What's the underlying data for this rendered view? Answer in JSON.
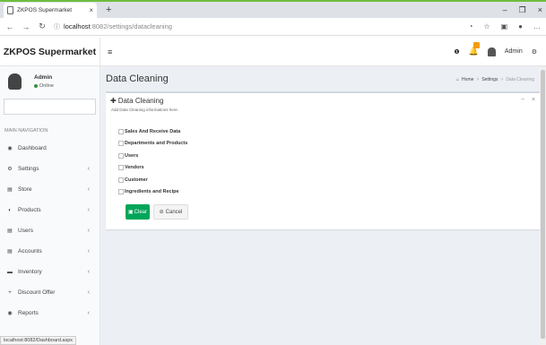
{
  "browser": {
    "tab_title": "ZKPOS Supermarket",
    "tab_close": "×",
    "new_tab": "+",
    "minimize": "–",
    "restore": "❐",
    "close": "×",
    "back": "←",
    "forward": "→",
    "reload": "↻",
    "info": "ⓘ",
    "url_host": "localhost",
    "url_path": ":8082/settings/datacleaning",
    "status_url": "localhost:8082/Dashboard.aspx"
  },
  "header": {
    "brand": "ZKPOS Supermarket",
    "menu_toggle": "≡",
    "info_icon": "❶",
    "user_name": "Admin",
    "settings_icon": "⚙"
  },
  "sidebar": {
    "user_name": "Admin",
    "user_status": "Online",
    "nav_header": "MAIN NAVIGATION",
    "items": [
      {
        "label": "Dashboard",
        "icon": "◉",
        "chevron": ""
      },
      {
        "label": "Settings",
        "icon": "⚙",
        "chevron": "‹"
      },
      {
        "label": "Store",
        "icon": "▤",
        "chevron": "‹"
      },
      {
        "label": "Products",
        "icon": "◐",
        "chevron": "‹"
      },
      {
        "label": "Users",
        "icon": "▤",
        "chevron": "‹"
      },
      {
        "label": "Accounts",
        "icon": "▤",
        "chevron": "‹"
      },
      {
        "label": "Inventory",
        "icon": "▬",
        "chevron": "‹"
      },
      {
        "label": "Discount Offer",
        "icon": "+",
        "chevron": "‹"
      },
      {
        "label": "Reports",
        "icon": "◉",
        "chevron": "‹"
      }
    ]
  },
  "main": {
    "page_title": "Data Cleaning",
    "breadcrumb": {
      "home": "Home",
      "settings": "Settings",
      "current": "Data Cleaning",
      "sep": ">"
    },
    "box": {
      "title": "Data Cleaning",
      "subtitle": "Add Data Cleaning informations here.",
      "collapse": "−",
      "remove": "×",
      "options": [
        "Sales And Receive Data",
        "Departments and Products",
        "Users",
        "Vendors",
        "Customer",
        "Ingredients and Recipe"
      ],
      "clear_label": "Clear",
      "cancel_label": "Cancel"
    }
  },
  "colors": {
    "accent_green": "#00a65a",
    "browser_accent": "#6dbd3e",
    "content_bg": "#ecf0f5"
  }
}
